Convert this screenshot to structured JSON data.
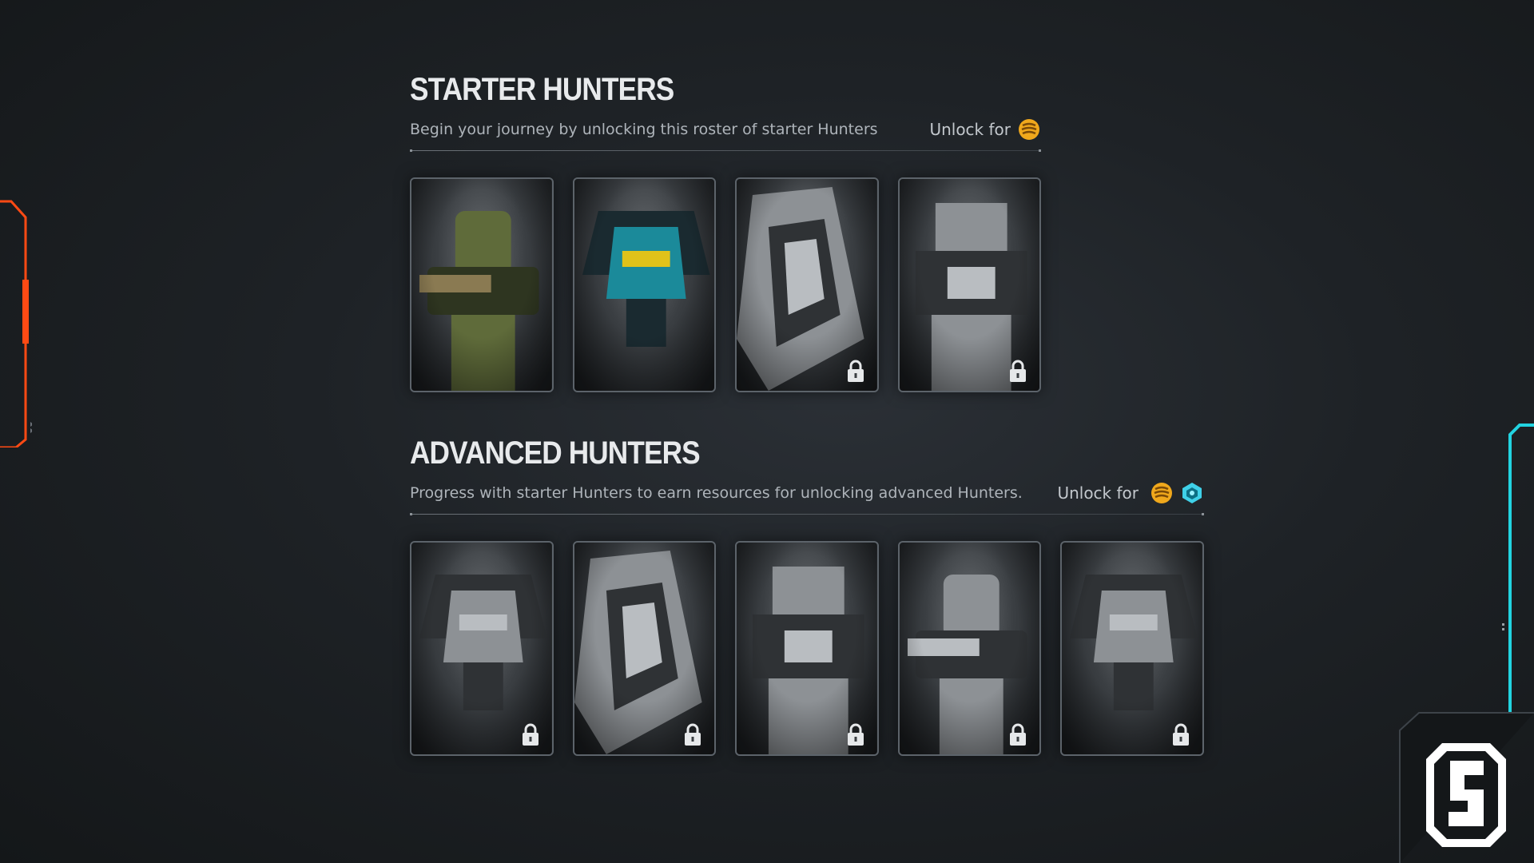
{
  "starter": {
    "title": "STARTER HUNTERS",
    "subtitle": "Begin your journey by unlocking this roster of starter Hunters",
    "unlock_label": "Unlock for",
    "cards": [
      {
        "name": "hunter-card-1",
        "locked": false,
        "tone": "green"
      },
      {
        "name": "hunter-card-2",
        "locked": false,
        "tone": "teal"
      },
      {
        "name": "hunter-card-3",
        "locked": true,
        "tone": "gray"
      },
      {
        "name": "hunter-card-4",
        "locked": true,
        "tone": "gray"
      }
    ]
  },
  "advanced": {
    "title": "ADVANCED HUNTERS",
    "subtitle": "Progress with starter Hunters to earn resources for unlocking advanced Hunters.",
    "unlock_label": "Unlock for",
    "cards": [
      {
        "name": "hunter-card-5",
        "locked": true,
        "tone": "gray"
      },
      {
        "name": "hunter-card-6",
        "locked": true,
        "tone": "gray"
      },
      {
        "name": "hunter-card-7",
        "locked": true,
        "tone": "gray"
      },
      {
        "name": "hunter-card-8",
        "locked": true,
        "tone": "gray"
      },
      {
        "name": "hunter-card-9",
        "locked": true,
        "tone": "gray"
      }
    ]
  },
  "icons": {
    "coin": "gold-coin-stack-icon",
    "crystal": "cyan-crystal-icon",
    "lock": "lock-icon",
    "logo": "s-logo-icon"
  },
  "colors": {
    "accent_orange": "#ff4a14",
    "accent_cyan": "#22d3e0",
    "coin_gold": "#f0a81c",
    "crystal_cyan": "#3fd0e8"
  }
}
